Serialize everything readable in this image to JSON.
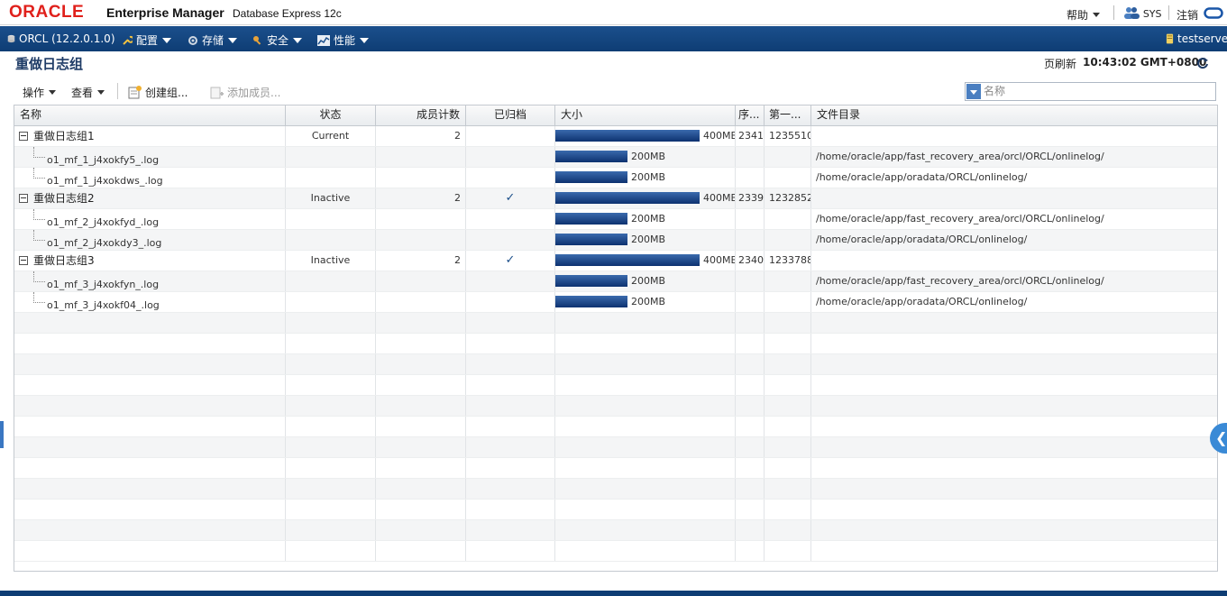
{
  "brand": {
    "logo": "ORACLE",
    "product": "Enterprise Manager",
    "subtitle": "Database Express 12c"
  },
  "top_right": {
    "help_label": "帮助",
    "user_label": "SYS",
    "logout_label": "注销"
  },
  "nav": {
    "db_label": "ORCL (12.2.0.1.0)",
    "menus": [
      "配置",
      "存储",
      "安全",
      "性能"
    ],
    "server_label": "testserver"
  },
  "page": {
    "title": "重做日志组",
    "refresh_label": "页刷新",
    "refresh_time": "10:43:02 GMT+0800"
  },
  "toolbar": {
    "actions_label": "操作",
    "view_label": "查看",
    "create_group_label": "创建组...",
    "add_member_label": "添加成员...",
    "search_placeholder": "名称"
  },
  "table": {
    "columns": [
      "名称",
      "状态",
      "成员计数",
      "已归档",
      "大小",
      "序...",
      "第一...",
      "文件目录"
    ],
    "rows": [
      {
        "type": "group",
        "name": "重做日志组1",
        "status": "Current",
        "members": "2",
        "archived": "",
        "size_label": "400MB",
        "size_mb": 400,
        "seq": "2341",
        "first": "1235510",
        "dir": ""
      },
      {
        "type": "member",
        "name": "o1_mf_1_j4xokfy5_.log",
        "status": "",
        "members": "",
        "archived": "",
        "size_label": "200MB",
        "size_mb": 200,
        "seq": "",
        "first": "",
        "dir": "/home/oracle/app/fast_recovery_area/orcl/ORCL/onlinelog/"
      },
      {
        "type": "member",
        "name": "o1_mf_1_j4xokdws_.log",
        "status": "",
        "members": "",
        "archived": "",
        "size_label": "200MB",
        "size_mb": 200,
        "seq": "",
        "first": "",
        "dir": "/home/oracle/app/oradata/ORCL/onlinelog/"
      },
      {
        "type": "group",
        "name": "重做日志组2",
        "status": "Inactive",
        "members": "2",
        "archived": "✓",
        "size_label": "400MB",
        "size_mb": 400,
        "seq": "2339",
        "first": "1232852",
        "dir": ""
      },
      {
        "type": "member",
        "name": "o1_mf_2_j4xokfyd_.log",
        "status": "",
        "members": "",
        "archived": "",
        "size_label": "200MB",
        "size_mb": 200,
        "seq": "",
        "first": "",
        "dir": "/home/oracle/app/fast_recovery_area/orcl/ORCL/onlinelog/"
      },
      {
        "type": "member",
        "name": "o1_mf_2_j4xokdy3_.log",
        "status": "",
        "members": "",
        "archived": "",
        "size_label": "200MB",
        "size_mb": 200,
        "seq": "",
        "first": "",
        "dir": "/home/oracle/app/oradata/ORCL/onlinelog/"
      },
      {
        "type": "group",
        "name": "重做日志组3",
        "status": "Inactive",
        "members": "2",
        "archived": "✓",
        "size_label": "400MB",
        "size_mb": 400,
        "seq": "2340",
        "first": "1233788",
        "dir": ""
      },
      {
        "type": "member",
        "name": "o1_mf_3_j4xokfyn_.log",
        "status": "",
        "members": "",
        "archived": "",
        "size_label": "200MB",
        "size_mb": 200,
        "seq": "",
        "first": "",
        "dir": "/home/oracle/app/fast_recovery_area/orcl/ORCL/onlinelog/"
      },
      {
        "type": "member",
        "name": "o1_mf_3_j4xokf04_.log",
        "status": "",
        "members": "",
        "archived": "",
        "size_label": "200MB",
        "size_mb": 200,
        "seq": "",
        "first": "",
        "dir": "/home/oracle/app/oradata/ORCL/onlinelog/"
      }
    ],
    "size_max_mb": 400
  },
  "colors": {
    "brand_red": "#e0201b",
    "nav_blue": "#0e3d74",
    "bar_blue": "#0d3270",
    "title_blue": "#1e3b66"
  }
}
